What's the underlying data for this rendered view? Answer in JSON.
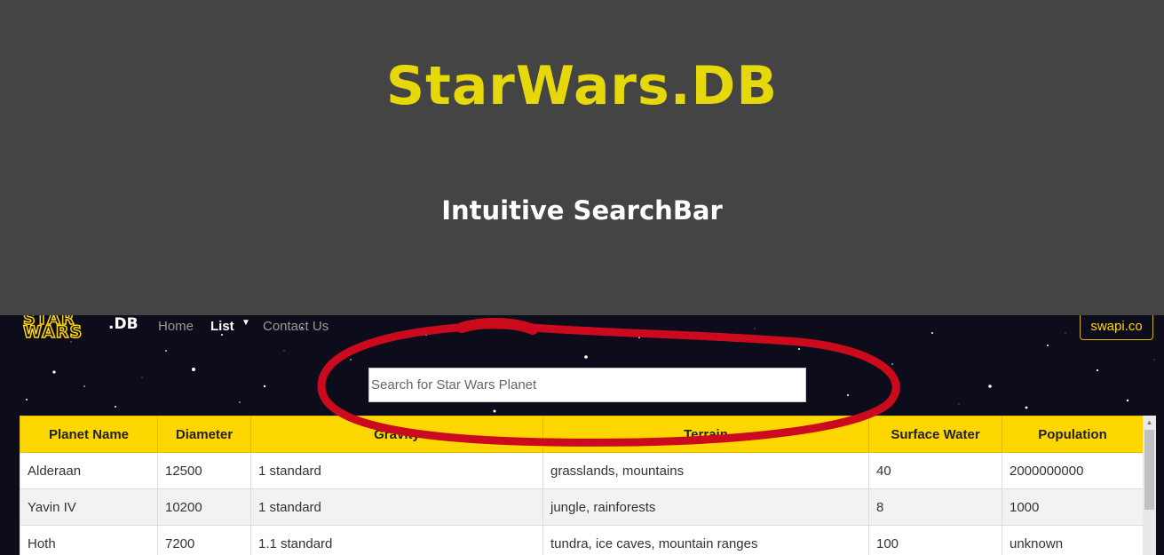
{
  "hero": {
    "title": "StarWars.DB",
    "subtitle": "Intuitive SearchBar"
  },
  "navbar": {
    "logo_top": "STAR",
    "logo_bottom": "WARS",
    "logo_suffix": ".DB",
    "links": [
      {
        "label": "Home",
        "active": false
      },
      {
        "label": "List",
        "active": true,
        "has_dropdown": true
      },
      {
        "label": "Contact Us",
        "active": false
      }
    ],
    "external_button": "swapi.co"
  },
  "search": {
    "placeholder": "Search for Star Wars Planet",
    "value": ""
  },
  "annotation": {
    "type": "red hand-drawn ellipse around search bar",
    "color": "#cc0a1e"
  },
  "table": {
    "headers": [
      "Planet Name",
      "Diameter",
      "Gravity",
      "Terrain",
      "Surface Water",
      "Population"
    ],
    "rows": [
      [
        "Alderaan",
        "12500",
        "1 standard",
        "grasslands, mountains",
        "40",
        "2000000000"
      ],
      [
        "Yavin IV",
        "10200",
        "1 standard",
        "jungle, rainforests",
        "8",
        "1000"
      ],
      [
        "Hoth",
        "7200",
        "1.1 standard",
        "tundra, ice caves, mountain ranges",
        "100",
        "unknown"
      ]
    ]
  },
  "colors": {
    "hero_bg": "#444444",
    "title": "#e6d80a",
    "accent": "#ffd700",
    "page_bg": "#0c0c1a"
  }
}
